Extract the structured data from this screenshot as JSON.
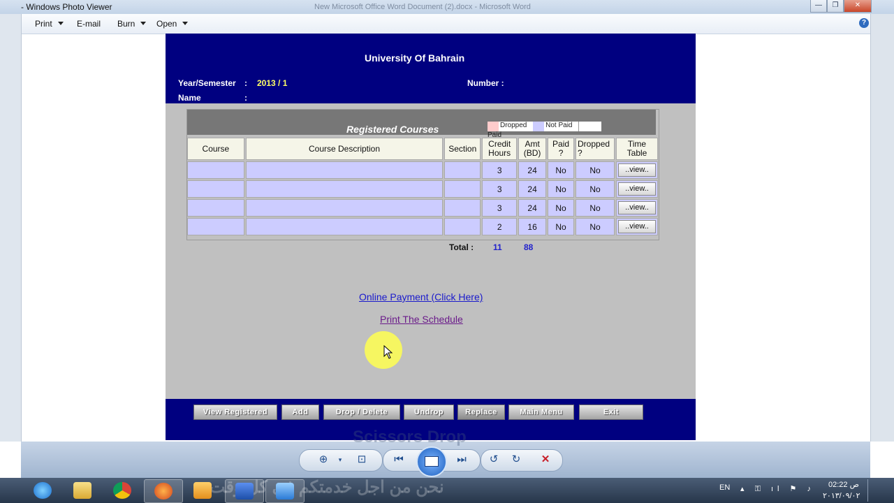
{
  "window": {
    "title": "- Windows Photo Viewer",
    "background_title": "New Microsoft Office Word Document (2).docx - Microsoft Word",
    "controls": [
      "—",
      "❐",
      "✕"
    ]
  },
  "menubar": {
    "items": [
      {
        "label": "Print",
        "dropdown": true
      },
      {
        "label": "E-mail",
        "dropdown": false
      },
      {
        "label": "Burn",
        "dropdown": true
      },
      {
        "label": "Open",
        "dropdown": true
      }
    ],
    "help_icon": "?"
  },
  "page": {
    "university": "University Of Bahrain",
    "year_semester_label": "Year/Semester",
    "year_semester_value": "2013 / 1",
    "number_label": "Number :",
    "name_label": "Name",
    "colon": ":",
    "table_title": "Registered Courses",
    "legend": [
      {
        "label": "Dropped",
        "color": "#ffcccc"
      },
      {
        "label": "Not Paid",
        "color": "#ccccff"
      },
      {
        "label": "Paid",
        "color": "#ffffff"
      }
    ],
    "columns": [
      "Course",
      "Course Description",
      "Section",
      "Credit Hours",
      "Amt (BD)",
      "Paid ?",
      "Dropped ?",
      "Time Table"
    ],
    "rows": [
      {
        "course": "",
        "description": "",
        "section": "",
        "credit": "3",
        "amt": "24",
        "paid": "No",
        "dropped": "No",
        "view": "..view.."
      },
      {
        "course": "",
        "description": "",
        "section": "",
        "credit": "3",
        "amt": "24",
        "paid": "No",
        "dropped": "No",
        "view": "..view.."
      },
      {
        "course": "",
        "description": "",
        "section": "",
        "credit": "3",
        "amt": "24",
        "paid": "No",
        "dropped": "No",
        "view": "..view.."
      },
      {
        "course": "",
        "description": "",
        "section": "",
        "credit": "2",
        "amt": "16",
        "paid": "No",
        "dropped": "No",
        "view": "..view.."
      }
    ],
    "total_label": "Total :",
    "total_credit": "11",
    "total_amt": "88",
    "online_payment": "Online Payment (Click Here)",
    "print_schedule": "Print The Schedule",
    "footer_buttons": [
      "View Registered",
      "Add",
      "Drop / Delete",
      "Undrop",
      "Replace",
      "Main Menu",
      "Exit"
    ]
  },
  "viewer_toolbar": {
    "background_text": "Scissors Drop",
    "icons": [
      "zoom-icon",
      "actual-size-icon",
      "previous-icon",
      "slideshow-icon",
      "next-icon",
      "rotate-left-icon",
      "rotate-right-icon",
      "delete-icon"
    ]
  },
  "taskbar": {
    "background_text": "نحن من اجل خدمتكم في كل وقت",
    "apps": [
      "internet-explorer",
      "file-explorer",
      "chrome",
      "firefox",
      "media-player",
      "word",
      "photo-viewer"
    ],
    "language": "EN",
    "time": "02:22 ص",
    "date": "٢٠١٣/٠٩/٠٢"
  }
}
